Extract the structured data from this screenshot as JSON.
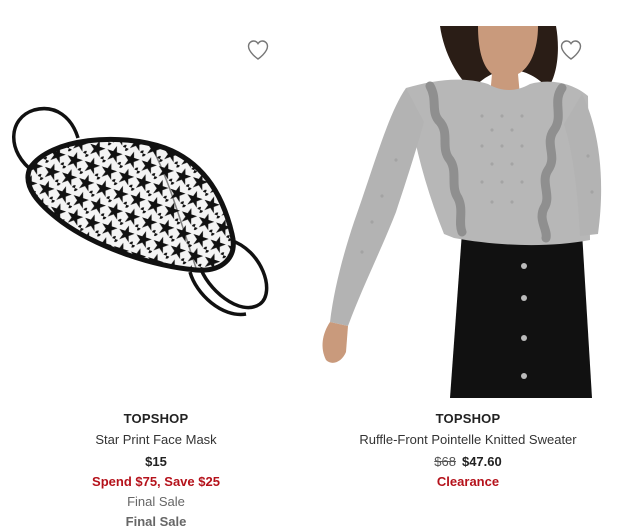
{
  "products": [
    {
      "brand": "TOPSHOP",
      "name": "Star Print Face Mask",
      "price": "$15",
      "promo": "Spend $75, Save $25",
      "notes": [
        "Final Sale",
        "Final Sale"
      ],
      "favorite_icon": "heart-outline-icon"
    },
    {
      "brand": "TOPSHOP",
      "name": "Ruffle-Front Pointelle Knitted Sweater",
      "original_price": "$68",
      "sale_price": "$47.60",
      "promo": "Clearance",
      "favorite_icon": "heart-outline-icon"
    }
  ],
  "colors": {
    "promo_red": "#b5121b",
    "note_gray": "#666666",
    "text_dark": "#222222"
  }
}
